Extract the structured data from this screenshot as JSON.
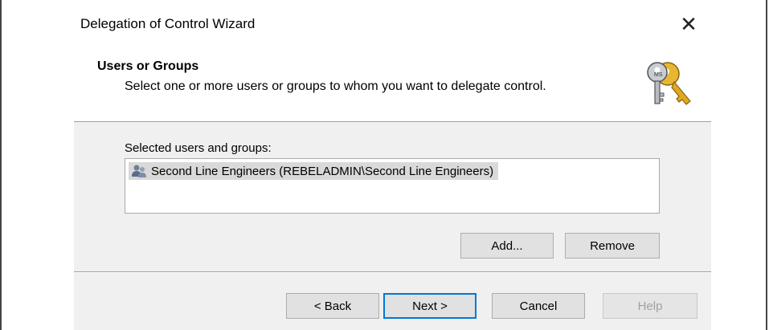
{
  "window": {
    "title": "Delegation of Control Wizard",
    "close_icon": "close-icon"
  },
  "header": {
    "title": "Users or Groups",
    "subtitle": "Select one or more users or groups to whom you want to delegate control.",
    "icon": "keys-icon"
  },
  "selection": {
    "label": "Selected users and groups:",
    "items": [
      {
        "icon": "user-group-icon",
        "label": "Second Line Engineers (REBELADMIN\\Second Line Engineers)",
        "selected": true
      }
    ]
  },
  "buttons": {
    "add": "Add...",
    "remove": "Remove",
    "back": "< Back",
    "next": "Next >",
    "cancel": "Cancel",
    "help": "Help"
  },
  "colors": {
    "accent": "#0078d7",
    "panel_bg": "#f0f0f0",
    "selection_bg": "#d9d9d9"
  }
}
